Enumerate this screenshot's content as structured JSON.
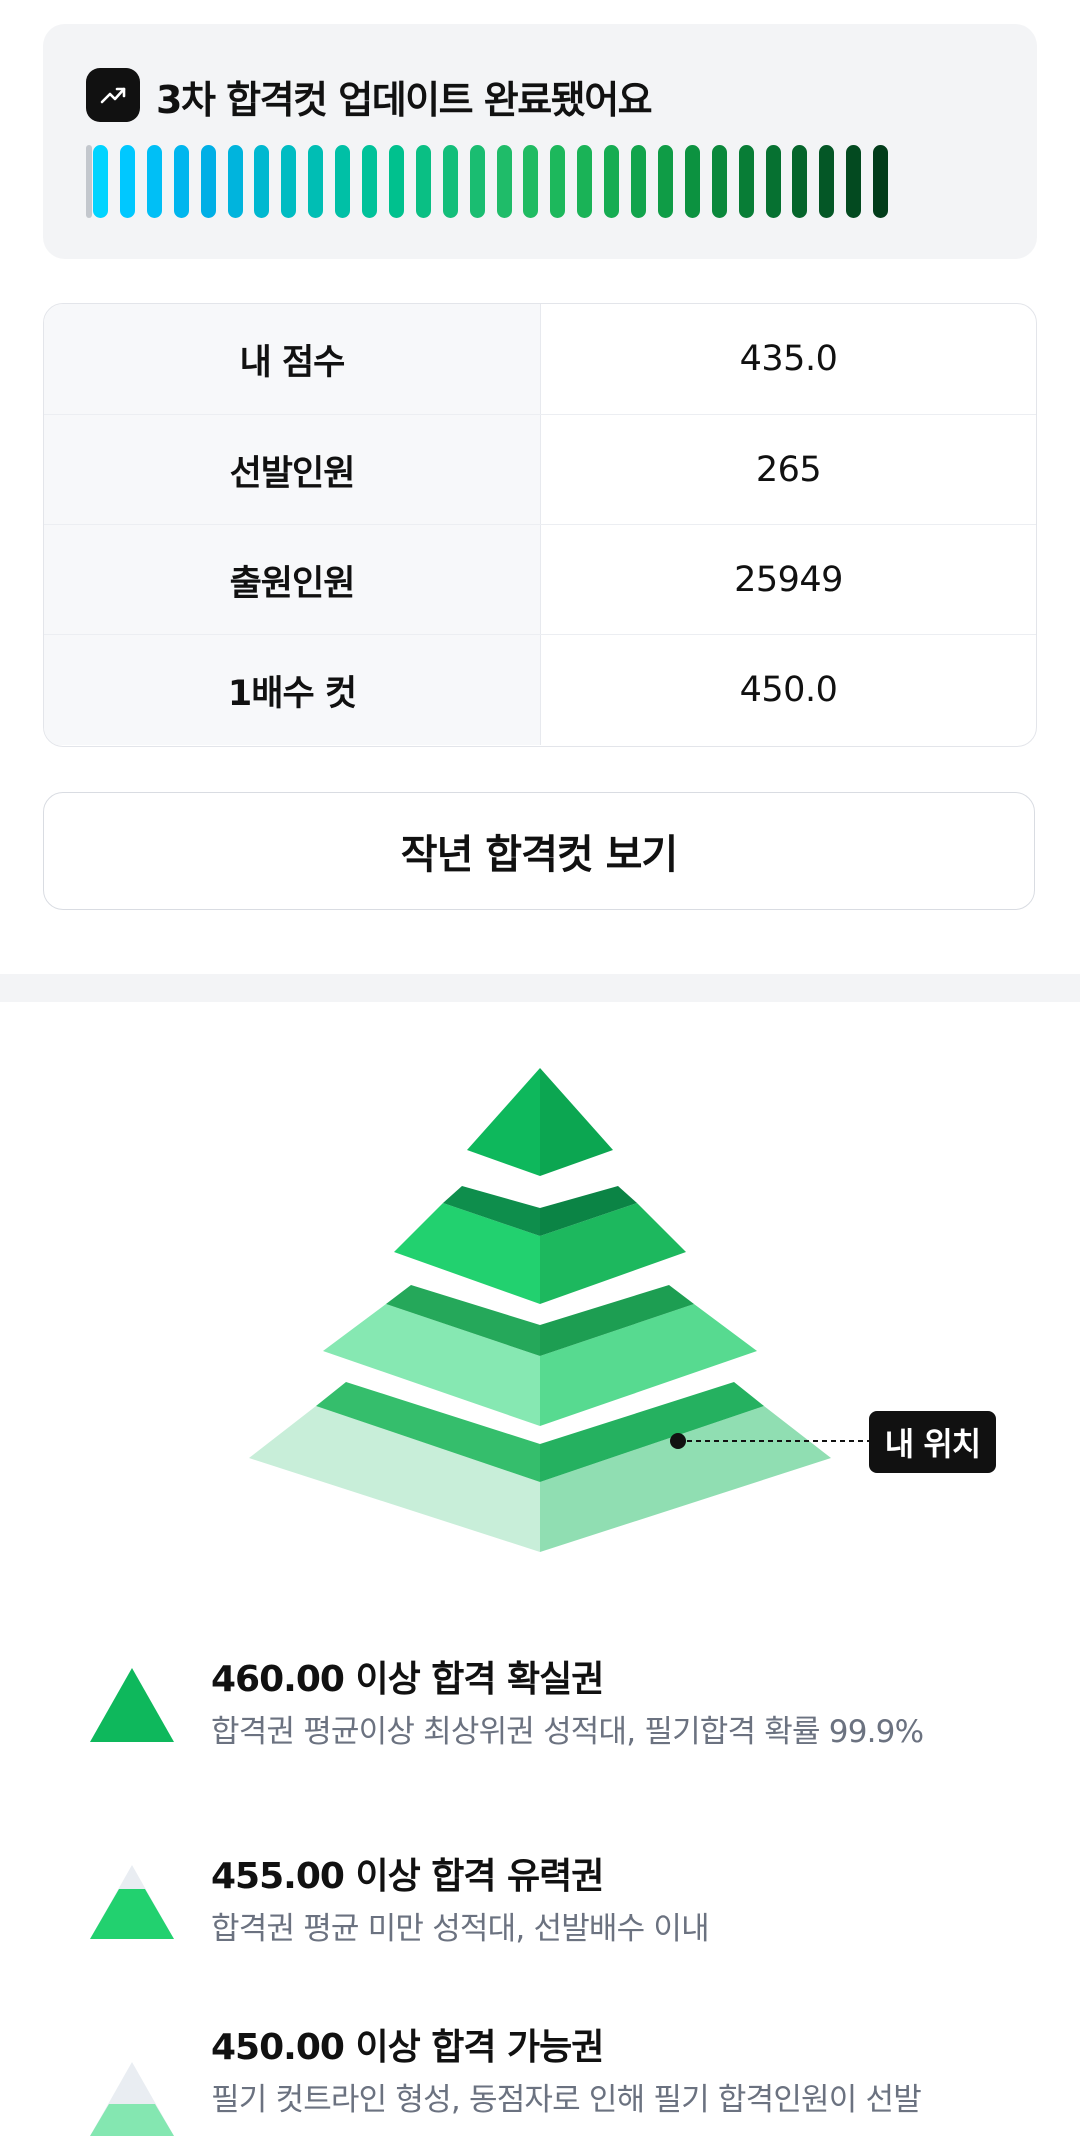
{
  "update": {
    "icon": "trending-up-icon",
    "title": "3차 합격컷 업데이트 완료됐어요",
    "progress_colors": [
      "#00d4ff",
      "#00c8ff",
      "#00bff6",
      "#00b6ee",
      "#00afe6",
      "#00b4dd",
      "#00b8d0",
      "#00bcc2",
      "#00beb4",
      "#00c0a6",
      "#00c29a",
      "#00c18e",
      "#0abf84",
      "#13be7a",
      "#1abd71",
      "#1fbc69",
      "#20bb62",
      "#1db85c",
      "#1ab357",
      "#16ac52",
      "#12a44c",
      "#0f9c46",
      "#0c9240",
      "#0a883b",
      "#087d36",
      "#067131",
      "#05652b",
      "#045726",
      "#034a20",
      "#023c1a"
    ],
    "accent_start": "#00d4ff",
    "accent_end": "#023c1a"
  },
  "stats": [
    {
      "label": "내 점수",
      "value": "435.0"
    },
    {
      "label": "선발인원",
      "value": "265"
    },
    {
      "label": "출원인원",
      "value": "25949"
    },
    {
      "label": "1배수 컷",
      "value": "450.0"
    }
  ],
  "prev_cut_button": "작년 합격컷 보기",
  "pyramid": {
    "marker_label": "내 위치",
    "colors": {
      "tier1": "#0eb85c",
      "tier2": "#22d16f",
      "tier3": "#84e7b1",
      "tier4": "#c8eed9"
    }
  },
  "tiers": [
    {
      "icon": "pyramid-tier1-icon",
      "title": "460.00 이상 합격 확실권",
      "desc": "합격권 평균이상 최상위권 성적대, 필기합격 확률 99.9%"
    },
    {
      "icon": "pyramid-tier2-icon",
      "title": "455.00 이상 합격 유력권",
      "desc": "합격권 평균 미만 성적대, 선발배수 이내"
    },
    {
      "icon": "pyramid-tier3-icon",
      "title": "450.00 이상 합격 가능권",
      "desc": "필기 컷트라인 형성, 동점자로 인해 필기 합격인원이 선발"
    }
  ]
}
